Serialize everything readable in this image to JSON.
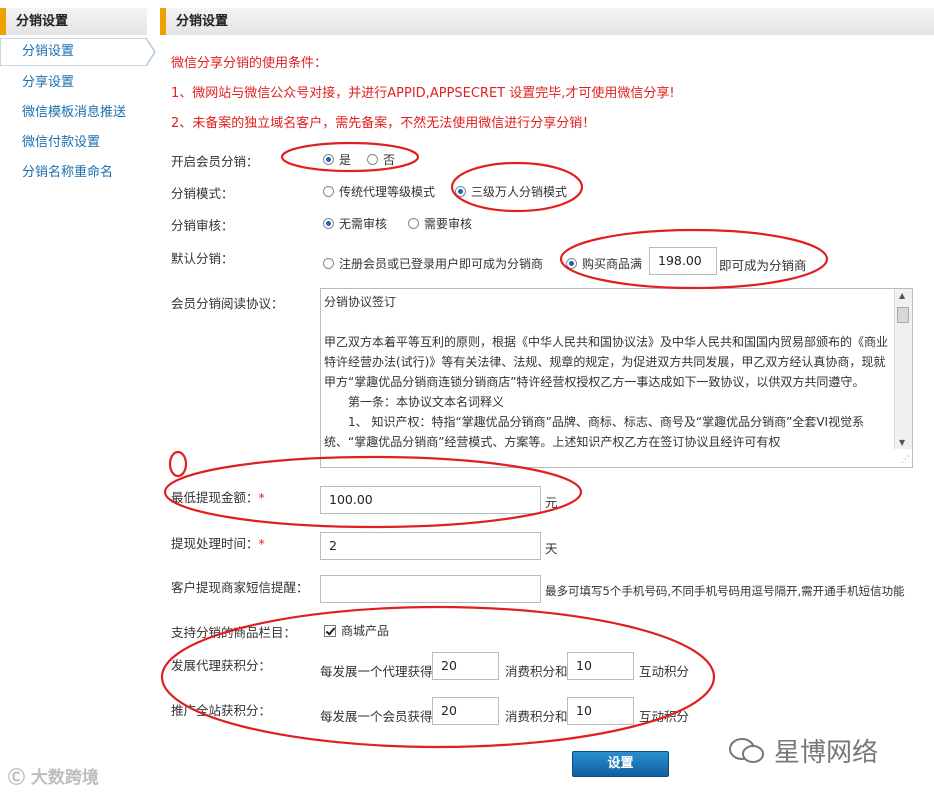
{
  "sidebar": {
    "header": "分销设置",
    "active_item": "分销设置",
    "items": [
      "分享设置",
      "微信模板消息推送",
      "微信付款设置",
      "分销名称重命名"
    ]
  },
  "main": {
    "header": "分销设置",
    "notice_title": "微信分享分销的使用条件：",
    "notice_1": "1、微网站与微信公众号对接，并进行APPID,APPSECRET 设置完毕,才可使用微信分享!",
    "notice_2": "2、未备案的独立域名客户，需先备案，不然无法使用微信进行分享分销！",
    "enable": {
      "label": "开启会员分销：",
      "yes": "是",
      "no": "否",
      "selected": "是"
    },
    "mode": {
      "label": "分销模式：",
      "opt1": "传统代理等级模式",
      "opt2": "三级万人分销模式",
      "selected": "三级万人分销模式"
    },
    "audit": {
      "label": "分销审核：",
      "opt1": "无需审核",
      "opt2": "需要审核",
      "selected": "无需审核"
    },
    "default": {
      "label": "默认分销：",
      "opt1": "注册会员或已登录用户即可成为分销商",
      "opt2_prefix": "购买商品满",
      "amount": "198.00",
      "opt2_suffix": "即可成为分销商",
      "selected": "opt2"
    },
    "agreement": {
      "label": "会员分销阅读协议：",
      "lines": [
        "分销协议签订",
        "",
        "甲乙双方本着平等互利的原则，根据《中华人民共和国协议法》及中华人民共和国国内贸易部颁布的《商业特许经营办法(试行)》等有关法律、法规、规章的规定，为促进双方共同发展，甲乙双方经认真协商，现就甲方“掌趣优品分销商连锁分销商店”特许经营权授权乙方一事达成如下一致协议，以供双方共同遵守。",
        "　　第一条：本协议文本名词释义",
        "　　1、 知识产权：特指“掌趣优品分销商”品牌、商标、标志、商号及“掌趣优品分销商”全套VI视觉系统、“掌趣优品分销商”经营模式、方案等。上述知识产权乙方在签订协议且经许可有权"
      ]
    },
    "min_withdraw": {
      "label": "最低提现金额：",
      "star": "*",
      "value": "100.00",
      "unit": "元"
    },
    "withdraw_time": {
      "label": "提现处理时间：",
      "star": "*",
      "value": "2",
      "unit": "天"
    },
    "sms": {
      "label": "客户提现商家短信提醒：",
      "value": "",
      "hint": "最多可填写5个手机号码,不同手机号码用逗号隔开,需开通手机短信功能"
    },
    "category": {
      "label": "支持分销的商品栏目：",
      "option": "商城产品",
      "checked": true
    },
    "agent_points": {
      "label": "发展代理获积分：",
      "prefix": "每发展一个代理获得",
      "points1": "20",
      "mid": "消费积分和",
      "points2": "10",
      "suffix": "互动积分"
    },
    "promo_points": {
      "label": "推广全站获积分：",
      "prefix": "每发展一个会员获得",
      "points1": "20",
      "mid": "消费积分和",
      "points2": "10",
      "suffix": "互动积分"
    },
    "submit": "设置"
  },
  "watermarks": {
    "left": "大数跨境",
    "right": "星博网络"
  },
  "colors": {
    "accent": "#f0a000",
    "link": "#1a6fb0",
    "notice": "#e02020",
    "annotation": "#e02020",
    "button": "#1a76b8"
  }
}
